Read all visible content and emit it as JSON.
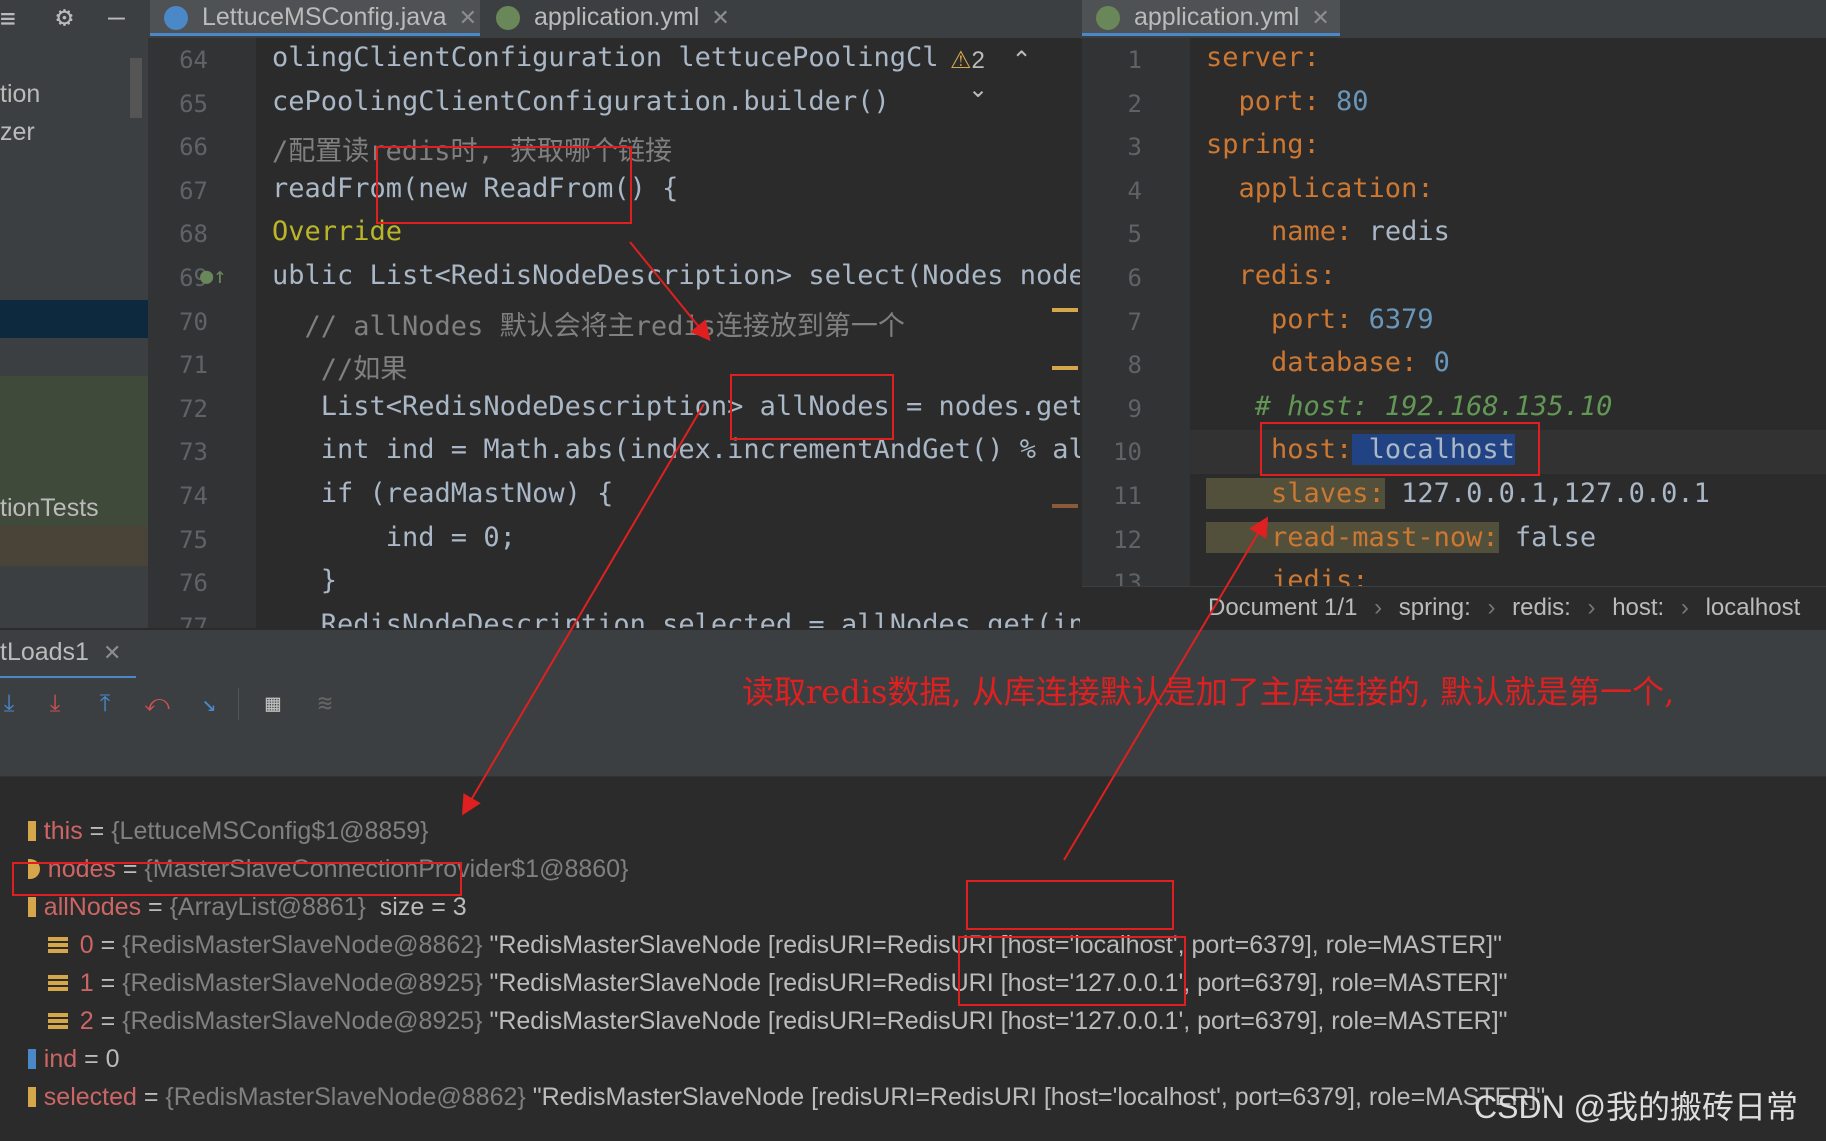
{
  "tabs": [
    {
      "label": "LettuceMSConfig.java",
      "icon": "java-class-icon",
      "color": "#4a88c7"
    },
    {
      "label": "application.yml",
      "icon": "spring-yml-icon",
      "color": "#6a8759"
    },
    {
      "label": "application.yml",
      "icon": "spring-yml-icon",
      "color": "#6a8759"
    }
  ],
  "left_panel": {
    "items": [
      "tion",
      "zer",
      "tionTests"
    ]
  },
  "java_editor": {
    "warning_count": "2",
    "line_numbers": [
      "64",
      "65",
      "66",
      "67",
      "68",
      "69",
      "70",
      "71",
      "72",
      "73",
      "74",
      "75",
      "76",
      "77"
    ],
    "lines": [
      "olingClientConfiguration lettucePoolingCl",
      "cePoolingClientConfiguration.builder()",
      "/配置读redis时, 获取哪个链接",
      "readFrom(new ReadFrom() {",
      "Override",
      "ublic List<RedisNodeDescription> select(Nodes nodes",
      "  // allNodes 默认会将主redis连接放到第一个",
      "   //如果",
      "   List<RedisNodeDescription> allNodes = nodes.getN",
      "   int ind = Math.abs(index.incrementAndGet() % all",
      "   if (readMastNow) {",
      "       ind = 0;",
      "   }",
      "   RedisNodeDescription selected = allNodes.get(inc"
    ]
  },
  "yml_editor": {
    "line_numbers": [
      "1",
      "2",
      "3",
      "4",
      "5",
      "6",
      "7",
      "8",
      "9",
      "10",
      "11",
      "12",
      "13"
    ],
    "lines": [
      {
        "key": "server:",
        "val": ""
      },
      {
        "key": "  port:",
        "val": " 80"
      },
      {
        "key": "spring:",
        "val": ""
      },
      {
        "key": "  application:",
        "val": ""
      },
      {
        "key": "    name:",
        "val": " redis"
      },
      {
        "key": "  redis:",
        "val": ""
      },
      {
        "key": "    port:",
        "val": " 6379"
      },
      {
        "key": "    database:",
        "val": " 0"
      },
      {
        "key": "   # host: 192.168.135.10",
        "val": ""
      },
      {
        "key": "    host:",
        "val": " localhost"
      },
      {
        "key": "    slaves:",
        "val": " 127.0.0.1,127.0.0.1"
      },
      {
        "key": "    read-mast-now:",
        "val": " false"
      },
      {
        "key": "    jedis:",
        "val": ""
      }
    ]
  },
  "breadcrumb": [
    "Document 1/1",
    "spring:",
    "redis:",
    "host:",
    "localhost"
  ],
  "debug": {
    "tab_label": "tLoads1",
    "variables": [
      {
        "name": "this",
        "eq": " = ",
        "type": "{LettuceMSConfig$1@8859}",
        "val": ""
      },
      {
        "name": "nodes",
        "eq": " = ",
        "type": "{MasterSlaveConnectionProvider$1@8860}",
        "val": ""
      },
      {
        "name": "allNodes",
        "eq": " = ",
        "type": "{ArrayList@8861}",
        "val": "  size = 3"
      },
      {
        "name": "0",
        "eq": " = ",
        "type": "{RedisMasterSlaveNode@8862}",
        "val": " \"RedisMasterSlaveNode [redisURI=RedisURI [host='localhost', port=6379], role=MASTER]\""
      },
      {
        "name": "1",
        "eq": " = ",
        "type": "{RedisMasterSlaveNode@8925}",
        "val": " \"RedisMasterSlaveNode [redisURI=RedisURI [host='127.0.0.1', port=6379], role=MASTER]\""
      },
      {
        "name": "2",
        "eq": " = ",
        "type": "{RedisMasterSlaveNode@8925}",
        "val": " \"RedisMasterSlaveNode [redisURI=RedisURI [host='127.0.0.1', port=6379], role=MASTER]\""
      },
      {
        "name": "ind",
        "eq": " = ",
        "type": "",
        "val": "0"
      },
      {
        "name": "selected",
        "eq": " = ",
        "type": "{RedisMasterSlaveNode@8862}",
        "val": " \"RedisMasterSlaveNode [redisURI=RedisURI [host='localhost', port=6379], role=MASTER]\""
      }
    ]
  },
  "annotation": "读取redis数据, 从库连接默认是加了主库连接的, 默认就是第一个,",
  "watermark": "CSDN @我的搬砖日常",
  "colors": {
    "annotation_red": "#e02020",
    "accent": "#4a88c7"
  }
}
